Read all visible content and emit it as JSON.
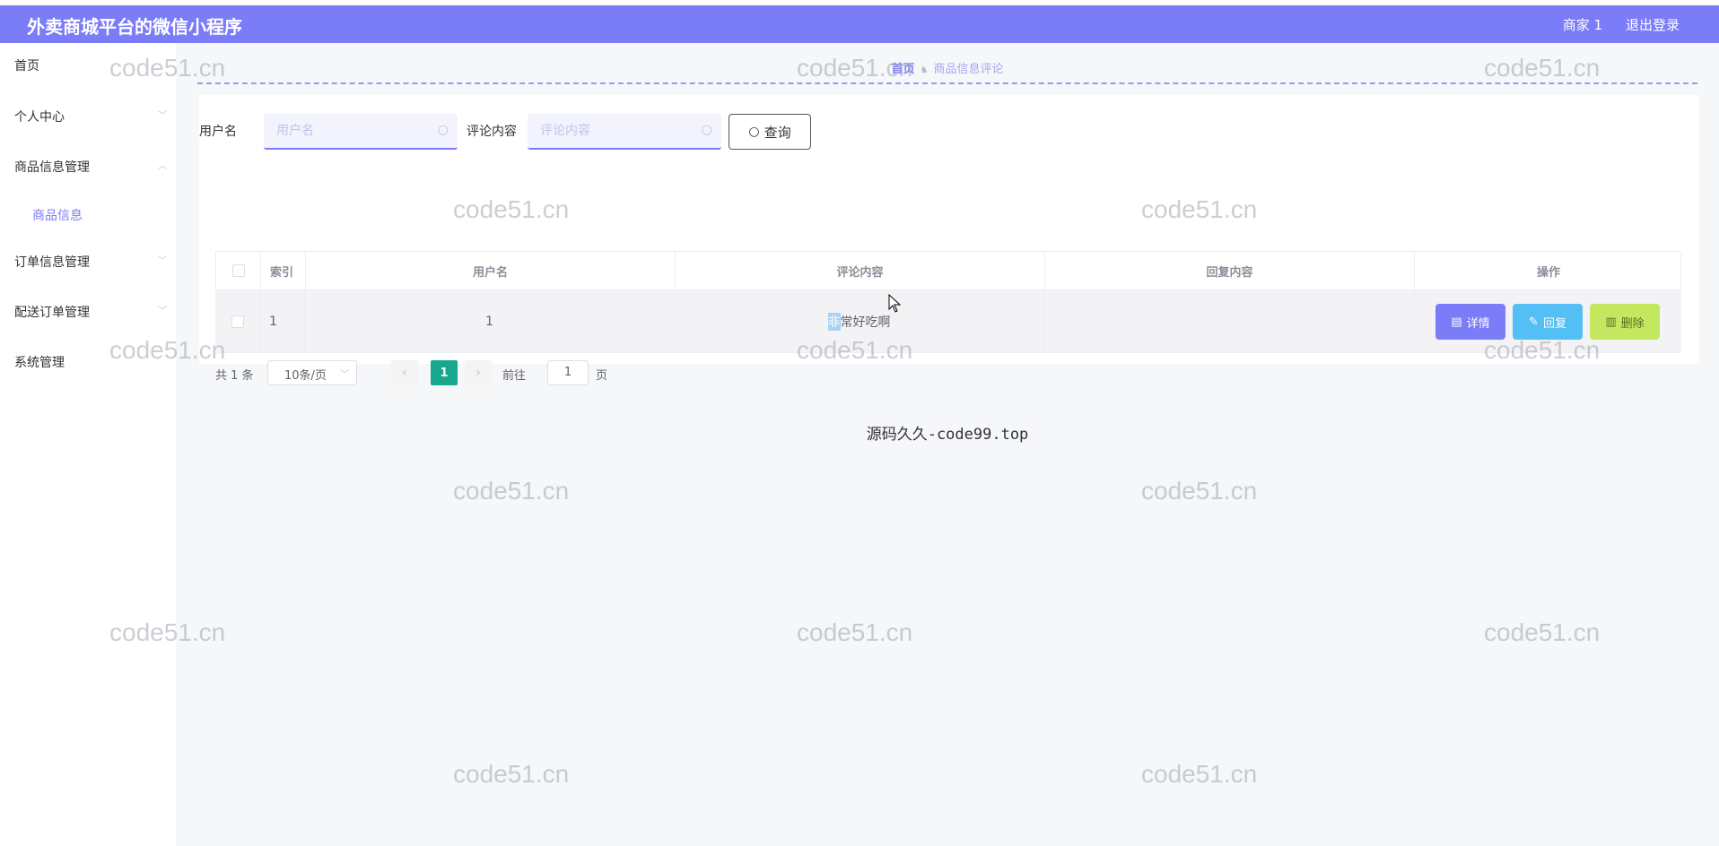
{
  "header": {
    "title": "外卖商城平台的微信小程序",
    "user": "商家 1",
    "logout": "退出登录"
  },
  "sidebar": {
    "items": [
      {
        "label": "首页"
      },
      {
        "label": "个人中心",
        "arrow": "﹀"
      },
      {
        "label": "商品信息管理",
        "arrow": "︿"
      },
      {
        "label": "订单信息管理",
        "arrow": "﹀"
      },
      {
        "label": "配送订单管理",
        "arrow": "﹀"
      },
      {
        "label": "系统管理"
      }
    ],
    "subitem": "商品信息"
  },
  "breadcrumb": {
    "home": "首页",
    "sep": "♞",
    "current": "商品信息评论"
  },
  "search": {
    "username_label": "用户名",
    "username_placeholder": "用户名",
    "comment_label": "评论内容",
    "comment_placeholder": "评论内容",
    "query_label": "查询"
  },
  "table": {
    "headers": [
      "索引",
      "用户名",
      "评论内容",
      "回复内容",
      "操作"
    ],
    "rows": [
      {
        "index": "1",
        "username": "1",
        "comment_hl": "非",
        "comment_rest": "常好吃啊",
        "reply": ""
      }
    ],
    "actions": {
      "detail": "详情",
      "reply": "回复",
      "delete": "删除"
    }
  },
  "pagination": {
    "total": "共 1 条",
    "page_size": "10条/页",
    "current_page": "1",
    "goto_label": "前往",
    "goto_value": "1",
    "page_suffix": "页"
  },
  "footer": "源码久久-code99.top",
  "watermark": "code51.cn",
  "colors": {
    "primary": "#7b7cf7",
    "reply_btn": "#53bff5",
    "delete_btn": "#c3e860",
    "pager_active": "#17a88d"
  }
}
